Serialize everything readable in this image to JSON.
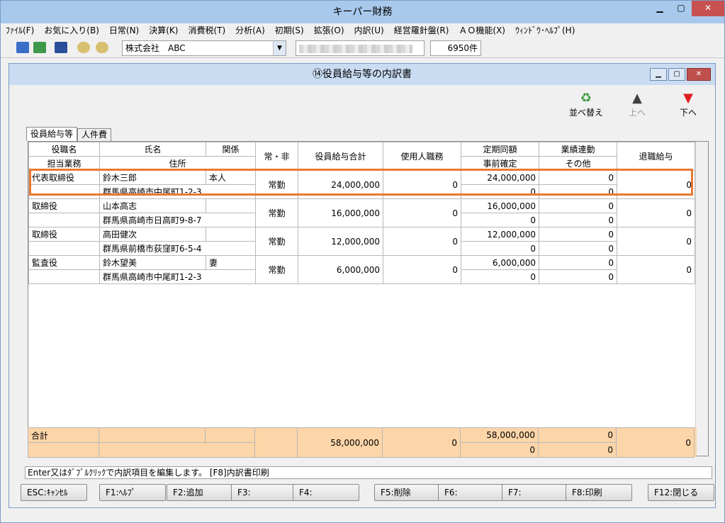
{
  "app_title": "キーパー財務",
  "menu": [
    "ﾌｧｲﾙ(F)",
    "お気に入り(B)",
    "日常(N)",
    "決算(K)",
    "消費税(T)",
    "分析(A)",
    "初期(S)",
    "拡張(O)",
    "内訳(U)",
    "経営羅針盤(R)",
    "ＡＯ機能(X)",
    "ｳｨﾝﾄﾞｳ･ﾍﾙﾌﾟ(H)"
  ],
  "toolbar": {
    "company": "株式会社　ABC",
    "count": "6950件"
  },
  "window_title": "⑭役員給与等の内訳書",
  "actions": {
    "sort": "並べ替え",
    "up": "上へ",
    "down": "下へ"
  },
  "tabs": [
    "役員給与等",
    "人件費"
  ],
  "headers": {
    "role": "役職名",
    "name": "氏名",
    "relation": "関係",
    "duty": "担当業務",
    "address": "住所",
    "fulltime": "常・非",
    "total": "役員給与合計",
    "employee_duty": "使用人職務",
    "regular": "定期同額",
    "advance": "事前確定",
    "performance": "業績連動",
    "other": "その他",
    "retirement": "退職給与"
  },
  "rows": [
    {
      "role": "代表取締役",
      "name": "鈴木三郎",
      "relation": "本人",
      "address": "群馬県高崎市中尾町1-2-3",
      "fulltime": "常勤",
      "total": "24,000,000",
      "employee_duty": "0",
      "regular": "24,000,000",
      "advance": "0",
      "performance": "0",
      "other": "0",
      "retirement": "0"
    },
    {
      "role": "取締役",
      "name": "山本高志",
      "relation": "",
      "address": "群馬県高崎市日高町9-8-7",
      "fulltime": "常勤",
      "total": "16,000,000",
      "employee_duty": "0",
      "regular": "16,000,000",
      "advance": "0",
      "performance": "0",
      "other": "0",
      "retirement": "0"
    },
    {
      "role": "取締役",
      "name": "高田健次",
      "relation": "",
      "address": "群馬県前橋市荻窪町6-5-4",
      "fulltime": "常勤",
      "total": "12,000,000",
      "employee_duty": "0",
      "regular": "12,000,000",
      "advance": "0",
      "performance": "0",
      "other": "0",
      "retirement": "0"
    },
    {
      "role": "監査役",
      "name": "鈴木望美",
      "relation": "妻",
      "address": "群馬県高崎市中尾町1-2-3",
      "fulltime": "常勤",
      "total": "6,000,000",
      "employee_duty": "0",
      "regular": "6,000,000",
      "advance": "0",
      "performance": "0",
      "other": "0",
      "retirement": "0"
    }
  ],
  "totals": {
    "label": "合計",
    "total": "58,000,000",
    "employee_duty": "0",
    "regular": "58,000,000",
    "advance": "0",
    "performance": "0",
    "other": "0",
    "retirement": "0"
  },
  "status_text": "Enter又はﾀﾞﾌﾞﾙｸﾘｯｸで内訳項目を編集します。 [F8]内訳書印刷",
  "fkeys": [
    "ESC:ｷｬﾝｾﾙ",
    "F1:ﾍﾙﾌﾟ",
    "F2:追加",
    "F3:",
    "F4:",
    "F5:削除",
    "F6:",
    "F7:",
    "F8:印刷",
    "F12:閉じる"
  ],
  "colors": {
    "highlight": "#e87a2f",
    "total_bg": "#fcd5a8",
    "titlebar": "#a9c9ec"
  }
}
